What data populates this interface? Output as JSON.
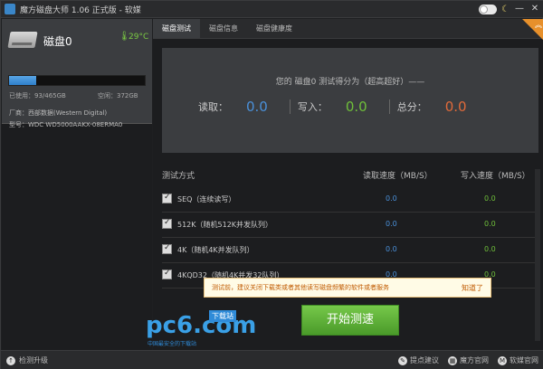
{
  "window": {
    "title": "魔方磁盘大师 1.06 正式版 - 软媒",
    "controls": {
      "minimize": "—",
      "close": "✕"
    }
  },
  "disk": {
    "name": "磁盘0",
    "temperature": "29°C",
    "used_label": "已使用：93/465GB",
    "free_label": "空闲：372GB",
    "used_fraction": 0.2,
    "vendor": "厂商：西部数据(Western Digital)",
    "model": "型号：WDC WD5000AAKX-08ERMA0"
  },
  "tabs": [
    "磁盘测试",
    "磁盘信息",
    "磁盘健康度"
  ],
  "score": {
    "title": "您的 磁盘0 测试得分为（超高超好）——",
    "read_label": "读取：",
    "read_value": "0.0",
    "write_label": "写入：",
    "write_value": "0.0",
    "total_label": "总分：",
    "total_value": "0.0"
  },
  "table": {
    "col_name": "测试方式",
    "col_read": "读取速度（MB/S）",
    "col_write": "写入速度（MB/S）",
    "rows": [
      {
        "name": "SEQ（连续读写）",
        "read": "0.0",
        "write": "0.0"
      },
      {
        "name": "512K（随机512K并发队列）",
        "read": "0.0",
        "write": "0.0"
      },
      {
        "name": "4K（随机4K并发队列）",
        "read": "0.0",
        "write": "0.0"
      },
      {
        "name": "4KQD32（随机4K并发32队列）",
        "read": "0.0",
        "write": "0.0"
      }
    ]
  },
  "tip": {
    "text": "测试前，建议关闭下载类或者其他读写磁盘频繁的软件或者服务",
    "ok": "知道了"
  },
  "start_button": "开始测速",
  "watermark": {
    "main": "pc6.com",
    "badge": "下载站",
    "sub": "中国最安全的下载站"
  },
  "footer": {
    "check_update": "检测升级",
    "suggest": "提点建议",
    "official": "魔方官网",
    "ruanmei": "软媒官网"
  },
  "colors": {
    "read": "#4a90d9",
    "write": "#6fbf3a",
    "total": "#e06a3a",
    "start": "#5aab36"
  }
}
